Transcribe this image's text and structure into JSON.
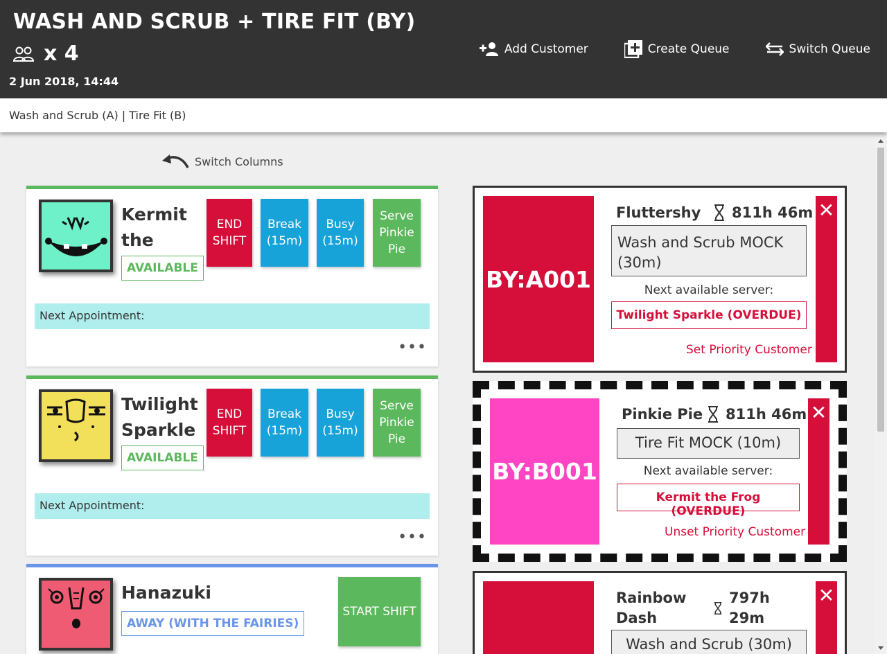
{
  "header": {
    "title": "WASH AND SCRUB + TIRE FIT (BY)",
    "count": "x 4",
    "date": "2 Jun 2018, 14:44",
    "actions": [
      {
        "label": "Add Customer",
        "icon": "add-person-icon"
      },
      {
        "label": "Create Queue",
        "icon": "add-box-icon"
      },
      {
        "label": "Switch Queue",
        "icon": "swap-arrows-icon"
      }
    ]
  },
  "subbar": {
    "queues": "Wash and Scrub (A) | Tire Fit (B)"
  },
  "switch_columns": "Switch Columns",
  "servers": [
    {
      "name": "Kermit the Frog",
      "status": "AVAILABLE",
      "avatar_color": "#6ef0c8",
      "buttons": [
        "END SHIFT",
        "Break (15m)",
        "Busy (15m)",
        "Serve Pinkie Pie"
      ],
      "next_appointment": "Next Appointment:"
    },
    {
      "name": "Twilight Sparkle",
      "status": "AVAILABLE",
      "avatar_color": "#f2e05a",
      "buttons": [
        "END SHIFT",
        "Break (15m)",
        "Busy (15m)",
        "Serve Pinkie Pie"
      ],
      "next_appointment": "Next Appointment:"
    },
    {
      "name": "Hanazuki",
      "status": "AWAY (WITH THE FAIRIES)",
      "avatar_color": "#ee5b73",
      "buttons": [
        "START SHIFT"
      ]
    }
  ],
  "tickets": [
    {
      "code": "BY:A001",
      "customer": "Fluttershy",
      "wait": "811h 46m",
      "service": "Wash and Scrub MOCK (30m)",
      "next_label": "Next available server:",
      "next_server": "Twilight Sparkle (OVERDUE)",
      "priority_action": "Set Priority Customer",
      "color": "#d50f3a",
      "close": "✕"
    },
    {
      "code": "BY:B001",
      "customer": "Pinkie Pie",
      "wait": "811h 46m",
      "service": "Tire Fit MOCK (10m)",
      "next_label": "Next available server:",
      "next_server": "Kermit the Frog (OVERDUE)",
      "priority_action": "Unset Priority Customer",
      "color": "#ff44c4",
      "close": "✕"
    },
    {
      "customer": "Rainbow Dash",
      "wait": "797h 29m",
      "service": "Wash and Scrub (30m)",
      "color": "#d50f3a",
      "close": "✕"
    }
  ]
}
